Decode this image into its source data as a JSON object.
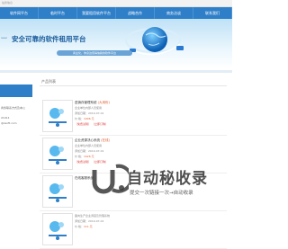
{
  "topbar": {
    "text": "站务信息"
  },
  "nav": {
    "items": [
      {
        "label": "软件网平台"
      },
      {
        "label": "临时平台"
      },
      {
        "label": "我要租用软件平台"
      },
      {
        "label": "战略合作"
      },
      {
        "label": "商务洽谈"
      },
      {
        "label": "联系我们"
      }
    ]
  },
  "banner": {
    "small_text": "ieasi",
    "title": "安全可靠的软件租用平台",
    "subtitle": "商业化，你身边值得信赖的软件平台"
  },
  "sidebar": {
    "lines": [
      "商务联系方式及本公",
      "21011",
      "@zsoft.com"
    ]
  },
  "products": {
    "heading": "产品列表",
    "items": [
      {
        "name": "进销存管理系统",
        "tag": "(大用份)",
        "publisher": "企业单位内部人员使用",
        "date": "添加日期：2019-07-01",
        "price_label": "价 格：",
        "price": "1006 元",
        "btn1": "〔免费试用〕",
        "btn2": "〔立即订购〕"
      },
      {
        "name": "企业资源决心系统",
        "tag": "(在线)",
        "publisher": "企业单位内部人员使用",
        "date": "添加日期：2019-07-01",
        "price_label": "价 格：",
        "price": "1026 元",
        "btn1": "〔免费试用〕",
        "btn2": "〔立即订购〕"
      },
      {
        "name": "在线客服系统",
        "tag": "",
        "publisher": "",
        "date": "",
        "price_label": "",
        "price": "",
        "btn1": "",
        "btn2": ""
      },
      {
        "name": "",
        "tag": "",
        "publisher": "面向生产企业调度及管理系统",
        "date": "添加日期：2019-07-01",
        "price_label": "价 格：",
        "price": "111 元",
        "btn1": "",
        "btn2": ""
      }
    ]
  },
  "watermark": {
    "big": "自动秘收录",
    "caption": "提交一次链接一次→自动收录"
  },
  "colors": {
    "nav": "#2f7fc8",
    "banner_title": "#1e5f9e",
    "price": "#e05a2a"
  }
}
